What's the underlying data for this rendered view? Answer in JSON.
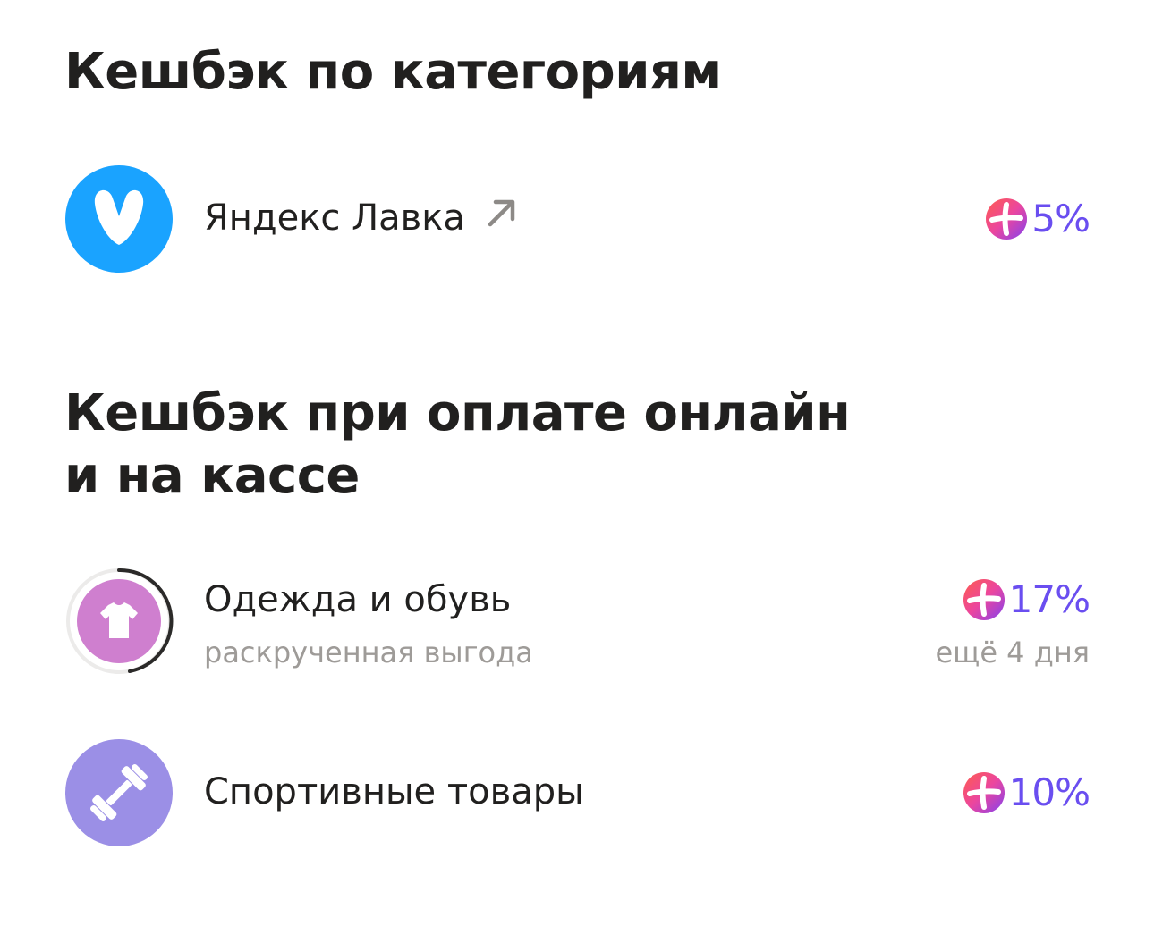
{
  "sections": [
    {
      "title": "Кешбэк по категориям"
    },
    {
      "title_line1": "Кешбэк при оплате онлайн",
      "title_line2": "и на кассе"
    }
  ],
  "items": [
    {
      "name": "Яндекс Лавка",
      "cashback": "5%",
      "icon": "yandex-lavka-logo",
      "link_icon": "external-arrow-icon",
      "icon_color": "#1aa3ff"
    },
    {
      "name": "Одежда и обувь",
      "subtitle": "раскрученная выгода",
      "cashback": "17%",
      "remaining": "ещё 4 дня",
      "icon": "tshirt-icon",
      "icon_color": "#cf7fcf"
    },
    {
      "name": "Спортивные товары",
      "cashback": "10%",
      "icon": "dumbbell-icon",
      "icon_color": "#9b8fe6"
    }
  ],
  "colors": {
    "cashback_text": "#6a4ef0",
    "plus_badge_start": "#ff5c4d",
    "plus_badge_mid": "#eb469f",
    "plus_badge_end": "#8341ef"
  }
}
